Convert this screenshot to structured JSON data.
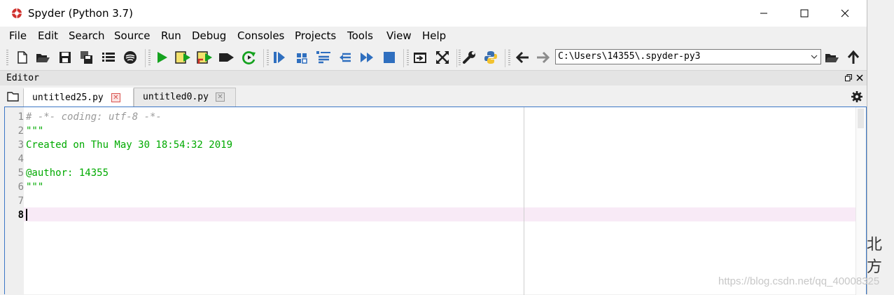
{
  "window": {
    "title": "Spyder (Python 3.7)"
  },
  "menu": [
    "File",
    "Edit",
    "Search",
    "Source",
    "Run",
    "Debug",
    "Consoles",
    "Projects",
    "Tools",
    "View",
    "Help"
  ],
  "toolbar": {
    "icons": [
      "new-file-icon",
      "open-file-icon",
      "save-icon",
      "save-all-icon",
      "outline-icon",
      "spyder-settings-icon",
      "run-icon",
      "run-cell-icon",
      "run-cell-advance-icon",
      "run-selection-icon",
      "rerun-icon",
      "debug-icon",
      "step-icon",
      "step-into-icon",
      "step-return-icon",
      "continue-icon",
      "stop-icon",
      "maximize-pane-icon",
      "fullscreen-icon",
      "preferences-icon",
      "python-path-icon",
      "back-arrow-icon",
      "forward-arrow-icon",
      "browse-folder-icon",
      "parent-directory-icon"
    ],
    "working_directory": "C:\\Users\\14355\\.spyder-py3"
  },
  "editor_pane": {
    "title": "Editor",
    "tabs": [
      {
        "label": "untitled25.py",
        "active": true
      },
      {
        "label": "untitled0.py",
        "active": false
      }
    ],
    "lines": [
      {
        "number": "1",
        "text": "# -*- coding: utf-8 -*-",
        "kind": "comment"
      },
      {
        "number": "2",
        "text": "\"\"\"",
        "kind": "string"
      },
      {
        "number": "3",
        "text": "Created on Thu May 30 18:54:32 2019",
        "kind": "string"
      },
      {
        "number": "4",
        "text": "",
        "kind": "string"
      },
      {
        "number": "5",
        "text": "@author: 14355",
        "kind": "string"
      },
      {
        "number": "6",
        "text": "\"\"\"",
        "kind": "string"
      },
      {
        "number": "7",
        "text": "",
        "kind": "plain"
      },
      {
        "number": "8",
        "text": "",
        "kind": "plain"
      }
    ],
    "current_line": "8"
  },
  "background": {
    "partial_text": "北方",
    "watermark": "https://blog.csdn.net/qq_40008325"
  },
  "colors": {
    "comment": "#9a9a9a",
    "string": "#00aa00",
    "current_line": "#f8eaf6",
    "accent": "#3c77c6"
  }
}
